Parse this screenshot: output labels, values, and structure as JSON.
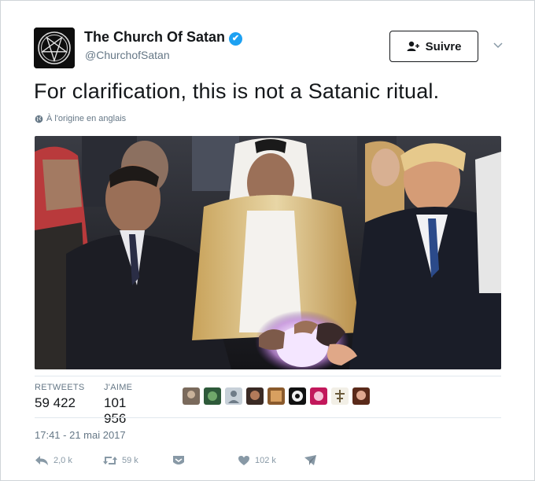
{
  "author": {
    "name": "The Church Of Satan",
    "handle": "@ChurchofSatan",
    "verified_mark": "✔"
  },
  "follow_button": {
    "label": "Suivre"
  },
  "tweet": {
    "text": "For clarification, this is not a Satanic ritual.",
    "translation_note": "À l'origine en anglais"
  },
  "stats": {
    "retweets_label": "RETWEETS",
    "retweets_value": "59 422",
    "likes_label": "J'AIME",
    "likes_value": "101 956"
  },
  "timestamp": "17:41 - 21 mai 2017",
  "actions": {
    "reply_count": "2,0 k",
    "retweet_count": "59 k",
    "like_count": "102 k"
  },
  "colors": {
    "verified": "#1da1f2",
    "muted_text": "#657786",
    "action_icon": "#8899a6"
  },
  "icons": [
    "pentagram-avatar",
    "verified-badge-icon",
    "add-user-icon",
    "chevron-down-icon",
    "globe-icon",
    "reply-icon",
    "retweet-icon",
    "moments-icon",
    "heart-icon",
    "message-icon"
  ]
}
